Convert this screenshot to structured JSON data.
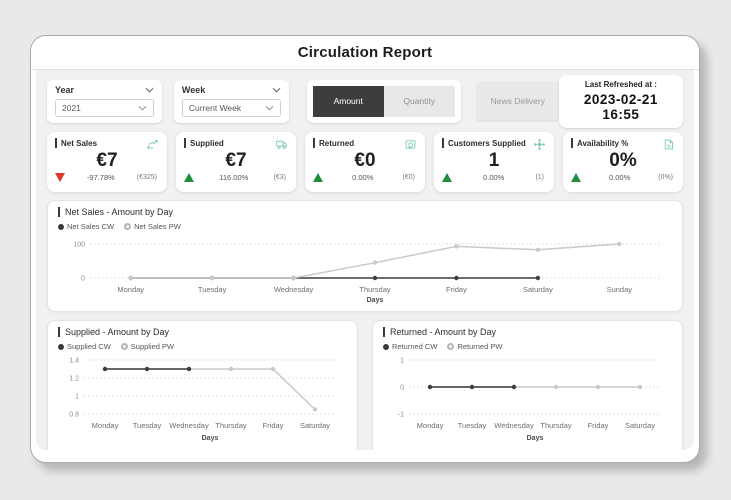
{
  "page": {
    "title": "Circulation Report"
  },
  "filters": {
    "year": {
      "label": "Year",
      "value": "2021"
    },
    "week": {
      "label": "Week",
      "value": "Current Week"
    },
    "toggle": {
      "amount_label": "Amount",
      "quantity_label": "Quantity",
      "selected": "Amount"
    },
    "news_delivery_label": "News Delivery",
    "last_refreshed": {
      "label": "Last Refreshed at :",
      "value": "2023-02-21 16:55"
    }
  },
  "kpis": [
    {
      "title": "Net Sales",
      "icon": "trend-chart-icon",
      "value": "€7",
      "direction": "down",
      "change": "-97.78%",
      "previous": "(€325)"
    },
    {
      "title": "Supplied",
      "icon": "delivery-van-icon",
      "value": "€7",
      "direction": "up",
      "change": "116.00%",
      "previous": "(€3)"
    },
    {
      "title": "Returned",
      "icon": "return-box-icon",
      "value": "€0",
      "direction": "up",
      "change": "0.00%",
      "previous": "(€0)"
    },
    {
      "title": "Customers Supplied",
      "icon": "customers-network-icon",
      "value": "1",
      "direction": "up",
      "change": "0.00%",
      "previous": "(1)"
    },
    {
      "title": "Availability %",
      "icon": "percent-file-icon",
      "value": "0%",
      "direction": "up",
      "change": "0.00%",
      "previous": "(0%)"
    }
  ],
  "colors": {
    "accent_teal": "#7cc7b4",
    "positive_green": "#1e8e3e",
    "negative_red": "#d93a2a",
    "cw_series": "#3d3d3d",
    "pw_series": "#c9c9c9",
    "gridline": "#d8d8d8",
    "toggle_active_bg": "#3d3d3d"
  },
  "chart_data": [
    {
      "type": "line",
      "title": "Net Sales - Amount by Day",
      "categories": [
        "Monday",
        "Tuesday",
        "Wednesday",
        "Thursday",
        "Friday",
        "Saturday",
        "Sunday"
      ],
      "series": [
        {
          "name": "Net Sales CW",
          "color": "#3d3d3d",
          "values": [
            0,
            0,
            0,
            0,
            0,
            0,
            null
          ]
        },
        {
          "name": "Net Sales PW",
          "color": "#c9c9c9",
          "values": [
            0,
            0,
            0,
            45,
            93,
            83,
            100
          ]
        }
      ],
      "render_order": [
        0,
        1
      ],
      "ylim": [
        0,
        100
      ],
      "yticks": [
        100,
        0
      ],
      "xlabel": "Days",
      "grid": true,
      "legend_position": "top-left"
    },
    {
      "type": "line",
      "title": "Supplied - Amount by Day",
      "categories": [
        "Monday",
        "Tuesday",
        "Wednesday",
        "Thursday",
        "Friday",
        "Saturday"
      ],
      "series": [
        {
          "name": "Supplied CW",
          "color": "#3d3d3d",
          "values": [
            1.3,
            1.3,
            1.3,
            null,
            null,
            null
          ]
        },
        {
          "name": "Supplied PW",
          "color": "#c9c9c9",
          "values": [
            1.3,
            1.3,
            1.3,
            1.3,
            1.3,
            0.85
          ]
        }
      ],
      "render_order": [
        1,
        0
      ],
      "ylim": [
        0.8,
        1.4
      ],
      "yticks": [
        1.4,
        1.2,
        1.0,
        0.8
      ],
      "xlabel": "Days",
      "grid": true,
      "legend_position": "top-left"
    },
    {
      "type": "line",
      "title": "Returned - Amount by Day",
      "categories": [
        "Monday",
        "Tuesday",
        "Wednesday",
        "Thursday",
        "Friday",
        "Saturday"
      ],
      "series": [
        {
          "name": "Returned CW",
          "color": "#3d3d3d",
          "values": [
            0,
            0,
            0,
            null,
            null,
            null
          ]
        },
        {
          "name": "Returned PW",
          "color": "#c9c9c9",
          "values": [
            0,
            0,
            0,
            0,
            0,
            0
          ]
        }
      ],
      "render_order": [
        1,
        0
      ],
      "ylim": [
        -1,
        1
      ],
      "yticks": [
        1,
        0,
        -1
      ],
      "xlabel": "Days",
      "grid": true,
      "legend_position": "top-left"
    }
  ]
}
